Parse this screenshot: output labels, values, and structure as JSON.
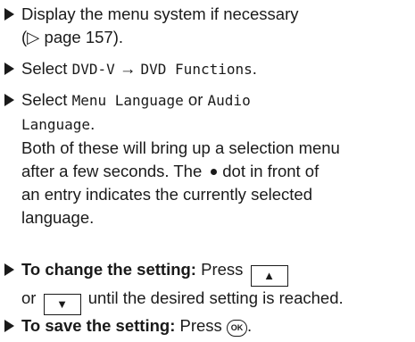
{
  "steps": [
    {
      "line1": "Display the menu system if necessary",
      "line2": "(▷ page 157)."
    },
    {
      "pre": "Select ",
      "code1": "DVD-V",
      "arrow": " → ",
      "code2": "DVD Functions",
      "post": "."
    },
    {
      "pre": "Select ",
      "code1": "Menu Language",
      "mid": " or ",
      "code2a": "Audio",
      "code2b": "Language",
      "post": ".",
      "para": [
        "Both of these will bring up a selection menu",
        "after a few seconds. The",
        "dot in front of",
        "an entry indicates the currently selected",
        "language."
      ]
    },
    {
      "bold": "To change the setting:",
      "pre": " Press",
      "key1": "▲",
      "line2pre": "or",
      "key2": "▼",
      "line2post": "until the desired setting is reached."
    },
    {
      "bold": "To save the setting:",
      "pre": " Press",
      "ok": "OK",
      "post": "."
    }
  ]
}
